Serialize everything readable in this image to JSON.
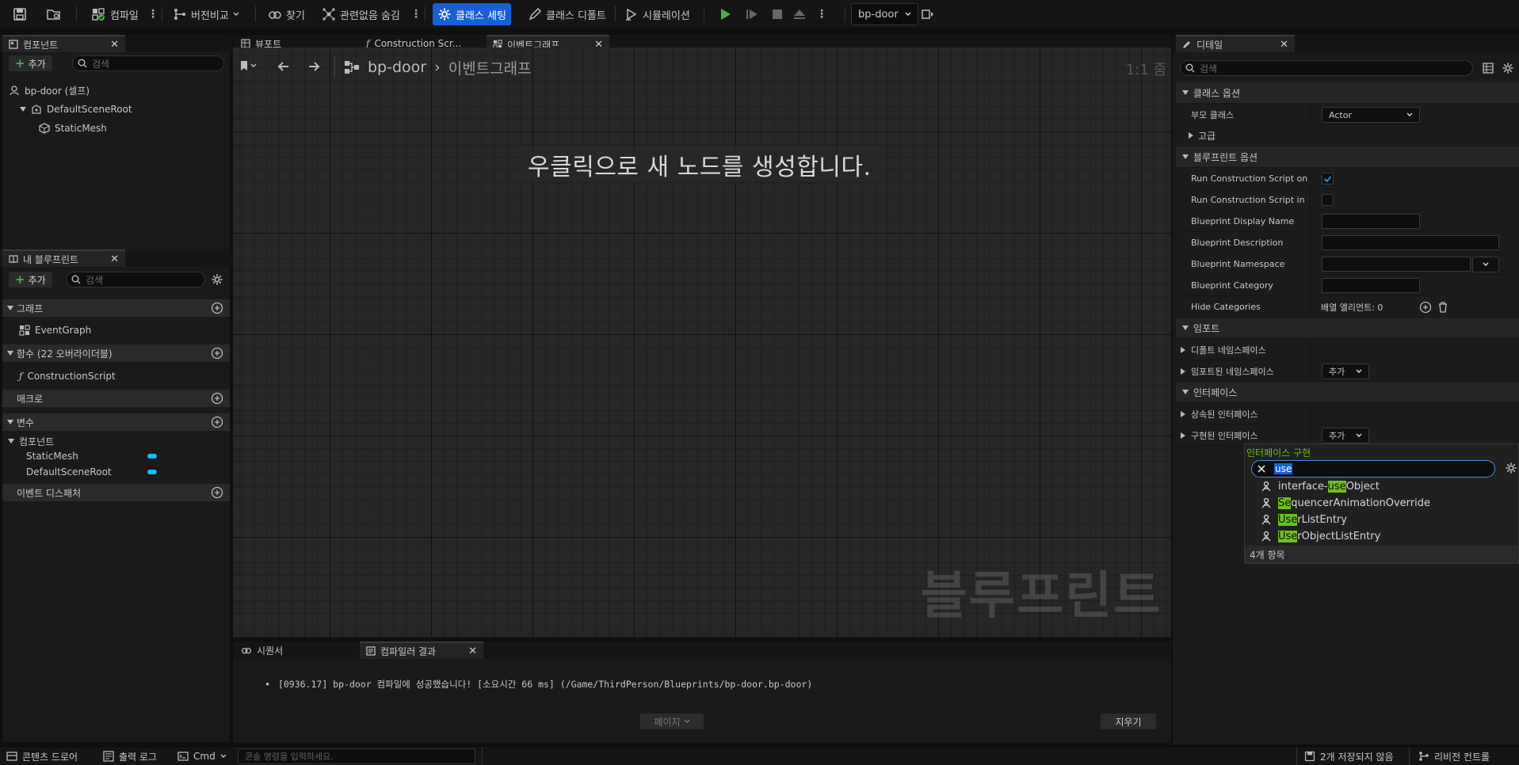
{
  "toolbar": {
    "compile": "컴파일",
    "diff": "버전비교",
    "find": "찾기",
    "hide_unrelated": "관련없음 숨김",
    "class_settings": "클래스 세팅",
    "class_defaults": "클래스 디폴트",
    "simulation": "시뮬레이션",
    "debug_object": "bp-door"
  },
  "components_panel": {
    "tab": "컴포넌트",
    "add": "추가",
    "search_placeholder": "검색",
    "items": [
      "bp-door (셀프)",
      "DefaultSceneRoot",
      "StaticMesh"
    ]
  },
  "my_blueprint": {
    "tab": "내 블루프린트",
    "add": "추가",
    "search_placeholder": "검색",
    "sections": {
      "graphs": "그래프",
      "event_graph": "EventGraph",
      "functions": "함수 (22 오버라이더블)",
      "construction_script": "ConstructionScript",
      "macros": "매크로",
      "variables": "변수",
      "components": "컴포넌트",
      "var_staticmesh": "StaticMesh",
      "var_defaultsceneroot": "DefaultSceneRoot",
      "dispatchers": "이벤트 디스패처"
    }
  },
  "editor_tabs": {
    "viewport": "뷰포트",
    "construction": "Construction Scr...",
    "event_graph": "이벤트그래프"
  },
  "graph": {
    "breadcrumb_root": "bp-door",
    "breadcrumb_current": "이벤트그래프",
    "zoom": "1:1 줌",
    "hint": "우클릭으로 새 노드를 생성합니다.",
    "watermark": "블루프린트"
  },
  "bottom_panel": {
    "tab_find": "시퀀서",
    "tab_compiler": "컴파일러 결과",
    "message": "[0936.17] bp-door 컴파일에 성공했습니다! [소요시간 66 ms] (/Game/ThirdPerson/Blueprints/bp-door.bp-door)",
    "page": "페이지",
    "clear": "지우기"
  },
  "details": {
    "tab": "디테일",
    "search_placeholder": "검색",
    "class_options": "클래스 옵션",
    "parent_class_label": "부모 클래스",
    "parent_class_value": "Actor",
    "advanced": "고급",
    "blueprint_options": "블루프린트 옵션",
    "rows": [
      "Run Construction Script on...",
      "Run Construction Script in S...",
      "Blueprint Display Name",
      "Blueprint Description",
      "Blueprint Namespace",
      "Blueprint Category",
      "Hide Categories"
    ],
    "hide_categories_value": "배열 엘리먼트: 0",
    "imports": "임포트",
    "default_namespaces": "디폴트 네임스페이스",
    "imported_namespaces": "임포트된 네임스페이스",
    "add": "추가",
    "interfaces": "인터페이스",
    "inherited_interfaces": "상속된 인터페이스",
    "implemented_interfaces": "구현된 인터페이스"
  },
  "popup": {
    "title": "인터페이스 구현",
    "query": "use",
    "items": [
      {
        "pre": "interface-",
        "hl": "use",
        "post": "Object"
      },
      {
        "pre": "",
        "hl": "Se",
        "post": "quencerAnimationOverride"
      },
      {
        "pre": "",
        "hl": "Use",
        "post": "rListEntry"
      },
      {
        "pre": "",
        "hl": "Use",
        "post": "rObjectListEntry"
      }
    ],
    "count": "4개 항목"
  },
  "status_bar": {
    "content_drawer": "콘텐츠 드로어",
    "output_log": "출력 로그",
    "cmd": "Cmd",
    "console_placeholder": "콘솔 명령을 입력하세요.",
    "unsaved": "2개 저장되지 않음",
    "revision_control": "리비전 컨트롤"
  },
  "colors": {
    "accent_blue": "#1a5fd6",
    "play_green": "#4caf50",
    "popup_title_green": "#6bc021",
    "highlight": "#6bc021"
  }
}
